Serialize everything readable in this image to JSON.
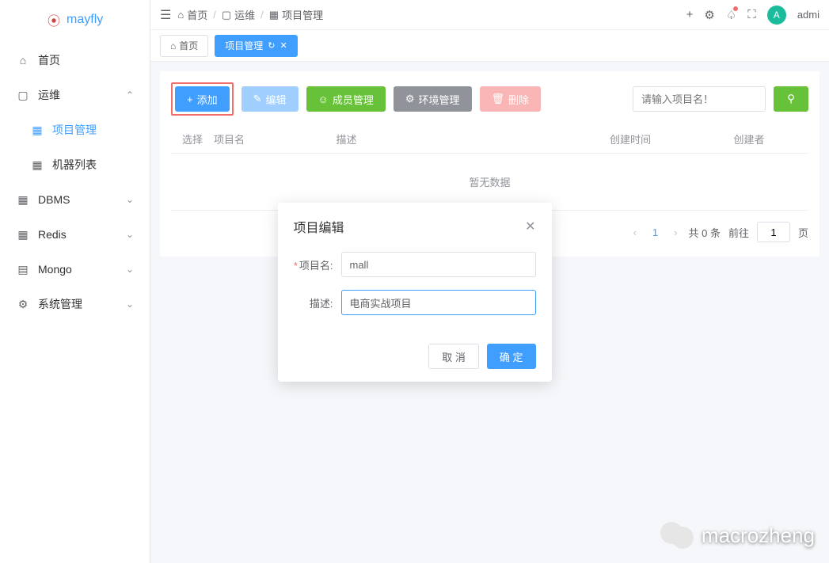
{
  "app": {
    "name": "mayfly"
  },
  "header": {
    "breadcrumb": [
      "首页",
      "运维",
      "项目管理"
    ],
    "user": {
      "initial": "A",
      "name": "admi"
    }
  },
  "sidebar": {
    "items": [
      {
        "label": "首页",
        "icon": "home"
      },
      {
        "label": "运维",
        "icon": "monitor",
        "expanded": true,
        "children": [
          {
            "label": "项目管理",
            "icon": "grid",
            "active": true
          },
          {
            "label": "机器列表",
            "icon": "grid"
          }
        ]
      },
      {
        "label": "DBMS",
        "icon": "grid"
      },
      {
        "label": "Redis",
        "icon": "grid"
      },
      {
        "label": "Mongo",
        "icon": "doc"
      },
      {
        "label": "系统管理",
        "icon": "gear"
      }
    ]
  },
  "tabs": [
    {
      "label": "首页",
      "active": false,
      "has_home": true
    },
    {
      "label": "项目管理",
      "active": true,
      "has_refresh": true,
      "has_close": true
    }
  ],
  "toolbar": {
    "add": "添加",
    "edit": "编辑",
    "members": "成员管理",
    "env": "环境管理",
    "delete": "删除",
    "search_placeholder": "请输入项目名！"
  },
  "table": {
    "columns": {
      "select": "选择",
      "name": "项目名",
      "desc": "描述",
      "time": "创建时间",
      "creator": "创建者"
    },
    "empty": "暂无数据"
  },
  "pagination": {
    "current": "1",
    "total_text": "共 0 条",
    "goto_label": "前往",
    "goto_value": "1",
    "page_suffix": "页"
  },
  "modal": {
    "title": "项目编辑",
    "fields": {
      "name_label": "项目名:",
      "name_value": "mall",
      "desc_label": "描述:",
      "desc_value": "电商实战项目"
    },
    "cancel": "取 消",
    "confirm": "确 定"
  },
  "watermark": "macrozheng"
}
